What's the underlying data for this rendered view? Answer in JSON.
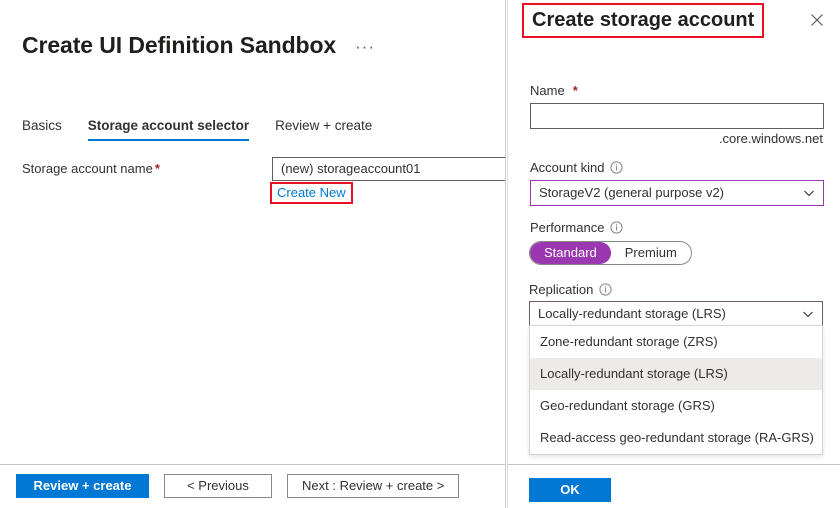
{
  "blade": {
    "title": "Create UI Definition Sandbox",
    "ellipsis": "···",
    "tabs": [
      {
        "label": "Basics",
        "active": false
      },
      {
        "label": "Storage account selector",
        "active": true
      },
      {
        "label": "Review + create",
        "active": false
      }
    ],
    "form": {
      "storage_account_name_label": "Storage account name",
      "required_marker": "*",
      "storage_account_name_value": "(new) storageaccount01",
      "create_new_link": "Create New"
    },
    "footer": {
      "review_create": "Review + create",
      "previous": "< Previous",
      "next": "Next : Review + create >"
    }
  },
  "pane": {
    "title": "Create storage account",
    "close_icon": "close-icon",
    "name": {
      "label": "Name",
      "required_marker": "*",
      "value": "",
      "suffix": ".core.windows.net"
    },
    "account_kind": {
      "label": "Account kind",
      "info_icon": "info-icon",
      "value": "StorageV2 (general purpose v2)",
      "chevron_icon": "chevron-down-icon"
    },
    "performance": {
      "label": "Performance",
      "info_icon": "info-icon",
      "options": [
        {
          "label": "Standard",
          "selected": true
        },
        {
          "label": "Premium",
          "selected": false
        }
      ]
    },
    "replication": {
      "label": "Replication",
      "info_icon": "info-icon",
      "value": "Locally-redundant storage (LRS)",
      "chevron_icon": "chevron-down-icon",
      "open": true,
      "options": [
        {
          "label": "Zone-redundant storage (ZRS)",
          "highlighted": false
        },
        {
          "label": "Locally-redundant storage (LRS)",
          "highlighted": true
        },
        {
          "label": "Geo-redundant storage (GRS)",
          "highlighted": false
        },
        {
          "label": "Read-access geo-redundant storage (RA-GRS)",
          "highlighted": false
        }
      ]
    },
    "ok_button": "OK"
  },
  "colors": {
    "accent_blue": "#0078d4",
    "highlight_red": "#e81123",
    "purple": "#9b37b0",
    "required_red": "#a4262c",
    "option_highlight": "#edebe9"
  }
}
